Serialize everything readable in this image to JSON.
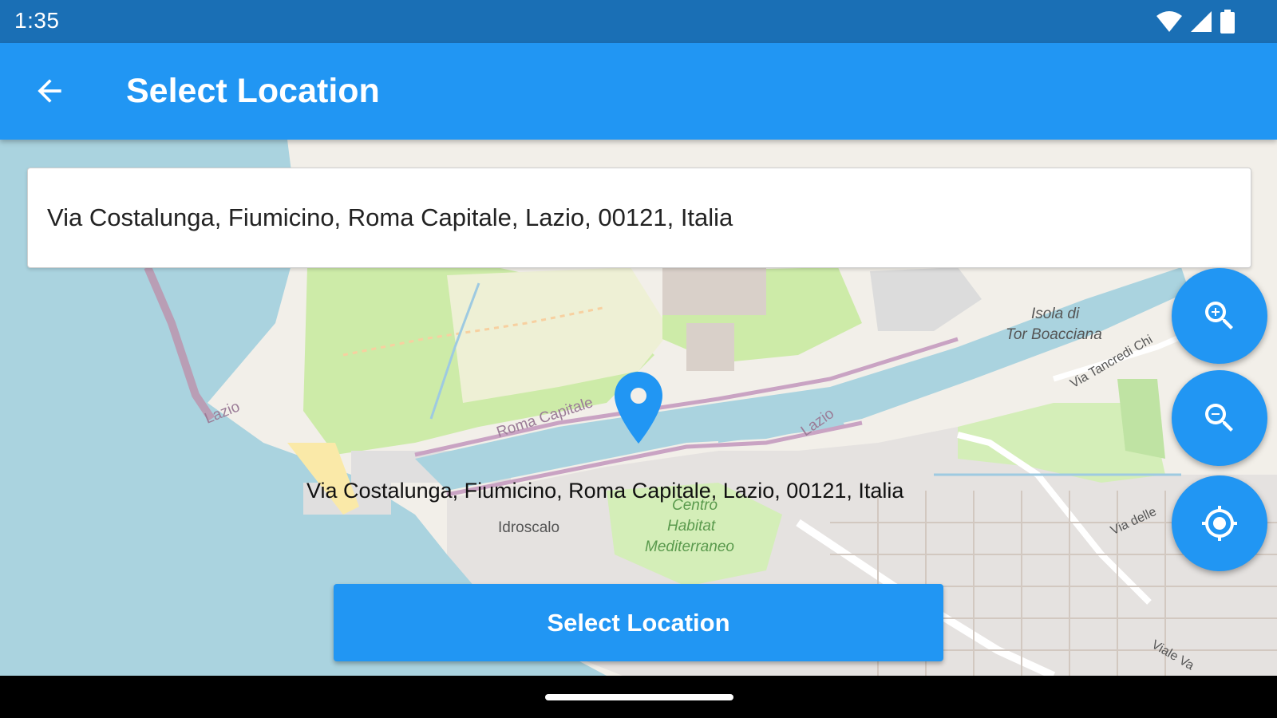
{
  "status_bar": {
    "time": "1:35",
    "icons": [
      "wifi-icon",
      "signal-icon",
      "battery-icon"
    ]
  },
  "app_bar": {
    "back_icon": "arrow-back-icon",
    "title": "Select Location"
  },
  "search": {
    "value": "Via Costalunga, Fiumicino, Roma Capitale, Lazio, 00121, Italia"
  },
  "map": {
    "pin_caption": "Via Costalunga, Fiumicino, Roma Capitale, Lazio, 00121, Italia",
    "labels": {
      "isola_line1": "Isola di",
      "isola_line2": "Tor Boacciana",
      "roma_capitale": "Roma Capitale",
      "lazio_1": "Lazio",
      "lazio_2": "Lazio",
      "via_tancredi": "Via Tancredi Chi",
      "idroscalo": "Idroscalo",
      "centro_line1": "Centro",
      "centro_line2": "Habitat",
      "centro_line3": "Mediterraneo",
      "via_delle": "Via delle",
      "viale_va": "Viale Va"
    }
  },
  "fabs": {
    "zoom_in_icon": "zoom-in-icon",
    "zoom_out_icon": "zoom-out-icon",
    "locate_icon": "my-location-icon"
  },
  "select_button": {
    "label": "Select Location"
  },
  "colors": {
    "primary": "#2196f3",
    "status_bar": "#1a6fb5",
    "water": "#aad3df",
    "park": "#cdeba8"
  }
}
